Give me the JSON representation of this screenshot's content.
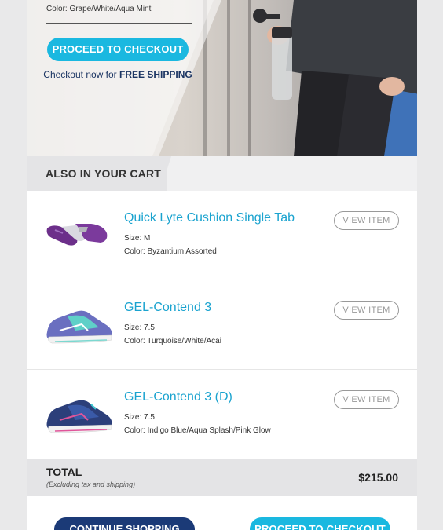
{
  "hero": {
    "color_line": "Color: Grape/White/Aqua Mint",
    "checkout_button": "PROCEED TO CHECKOUT",
    "shipping_prefix": "Checkout now for ",
    "shipping_bold": "FREE SHIPPING"
  },
  "cart": {
    "section_title": "ALSO IN YOUR CART",
    "items": [
      {
        "name": "Quick Lyte Cushion Single Tab",
        "size": "Size: M",
        "color": "Color: Byzantium Assorted",
        "button": "VIEW ITEM",
        "thumb": "socks-image"
      },
      {
        "name": "GEL-Contend 3",
        "size": "Size: 7.5",
        "color": "Color: Turquoise/White/Acai",
        "button": "VIEW ITEM",
        "thumb": "shoe-image"
      },
      {
        "name": "GEL-Contend 3 (D)",
        "size": "Size: 7.5",
        "color": "Color: Indigo Blue/Aqua Splash/Pink Glow",
        "button": "VIEW ITEM",
        "thumb": "shoe-image"
      }
    ]
  },
  "total": {
    "label": "TOTAL",
    "note": "(Excluding tax and shipping)",
    "value": "$215.00"
  },
  "footer": {
    "continue_button": "CONTINUE SHOPPING",
    "checkout_button": "PROCEED TO CHECKOUT"
  },
  "colors": {
    "accent_cyan": "#1ab8e0",
    "navy": "#1b3a77",
    "link_blue": "#1aa3cf"
  }
}
